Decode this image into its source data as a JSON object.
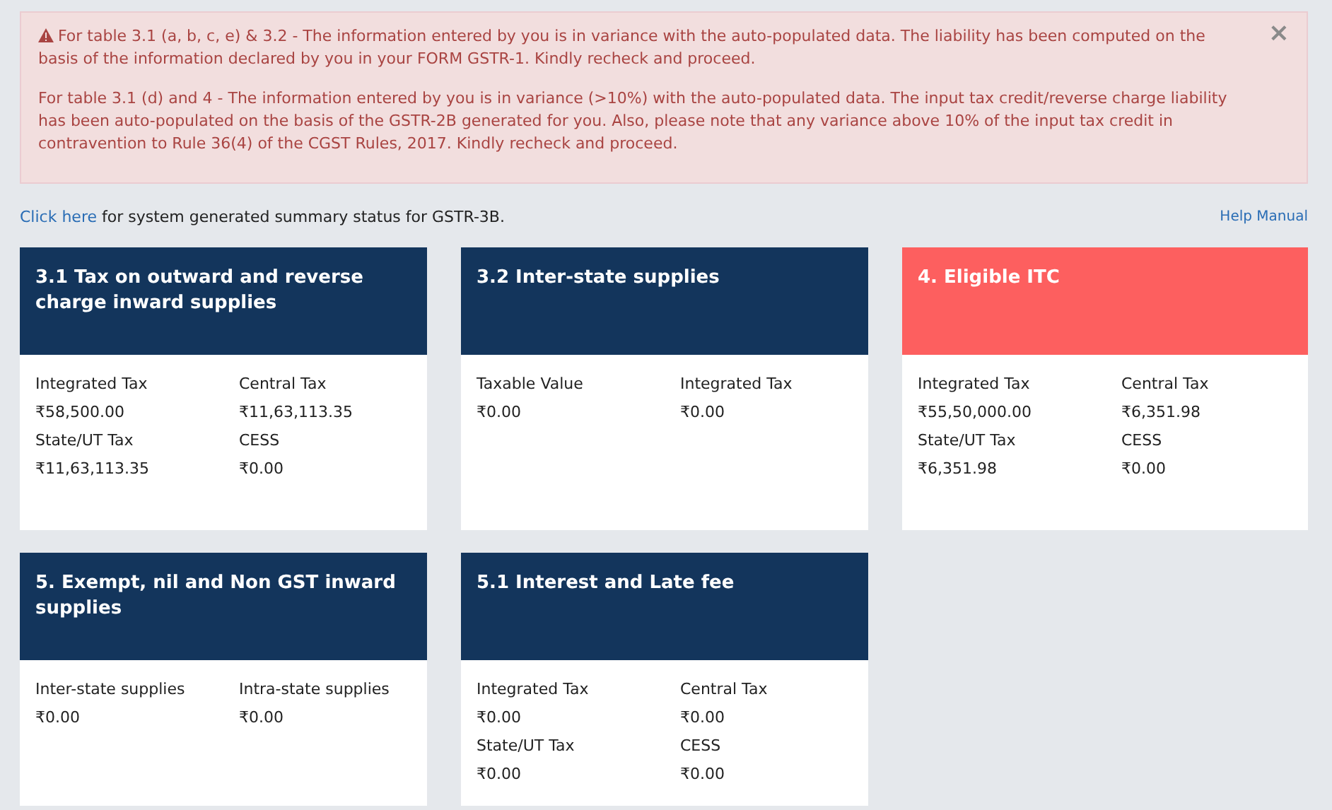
{
  "alert": {
    "paragraphs": [
      "For table 3.1 (a, b, c, e) & 3.2 - The information entered by you is in variance with the auto-populated data. The liability has been computed on the basis of the information declared by you in your FORM GSTR-1. Kindly recheck and proceed.",
      "For table 3.1 (d) and 4 - The information entered by you is in variance (>10%) with the auto-populated data. The input tax credit/reverse charge liability has been auto-populated on the basis of the GSTR-2B generated for you. Also, please note that any variance above 10% of the input tax credit in contravention to Rule 36(4) of the CGST Rules, 2017. Kindly recheck and proceed."
    ],
    "close": "×"
  },
  "summary_line": {
    "link": "Click here",
    "text": "for system generated summary status for GSTR-3B."
  },
  "help_link": "Help Manual",
  "tiles": [
    {
      "title": "3.1 Tax on outward and reverse charge inward supplies",
      "highlighted": false,
      "fields": [
        {
          "label": "Integrated Tax",
          "value": "₹58,500.00"
        },
        {
          "label": "Central Tax",
          "value": "₹11,63,113.35"
        },
        {
          "label": "State/UT Tax",
          "value": "₹11,63,113.35"
        },
        {
          "label": "CESS",
          "value": "₹0.00"
        }
      ]
    },
    {
      "title": "3.2 Inter-state supplies",
      "highlighted": false,
      "fields": [
        {
          "label": "Taxable Value",
          "value": "₹0.00"
        },
        {
          "label": "Integrated Tax",
          "value": "₹0.00"
        }
      ]
    },
    {
      "title": "4. Eligible ITC",
      "highlighted": true,
      "fields": [
        {
          "label": "Integrated Tax",
          "value": "₹55,50,000.00"
        },
        {
          "label": "Central Tax",
          "value": "₹6,351.98"
        },
        {
          "label": "State/UT Tax",
          "value": "₹6,351.98"
        },
        {
          "label": "CESS",
          "value": "₹0.00"
        }
      ]
    },
    {
      "title": "5. Exempt, nil and Non GST inward supplies",
      "highlighted": false,
      "fields": [
        {
          "label": "Inter-state supplies",
          "value": "₹0.00"
        },
        {
          "label": "Intra-state supplies",
          "value": "₹0.00"
        }
      ]
    },
    {
      "title": "5.1 Interest and Late fee",
      "highlighted": false,
      "fields": [
        {
          "label": "Integrated Tax",
          "value": "₹0.00"
        },
        {
          "label": "Central Tax",
          "value": "₹0.00"
        },
        {
          "label": "State/UT Tax",
          "value": "₹0.00"
        },
        {
          "label": "CESS",
          "value": "₹0.00"
        }
      ]
    }
  ]
}
